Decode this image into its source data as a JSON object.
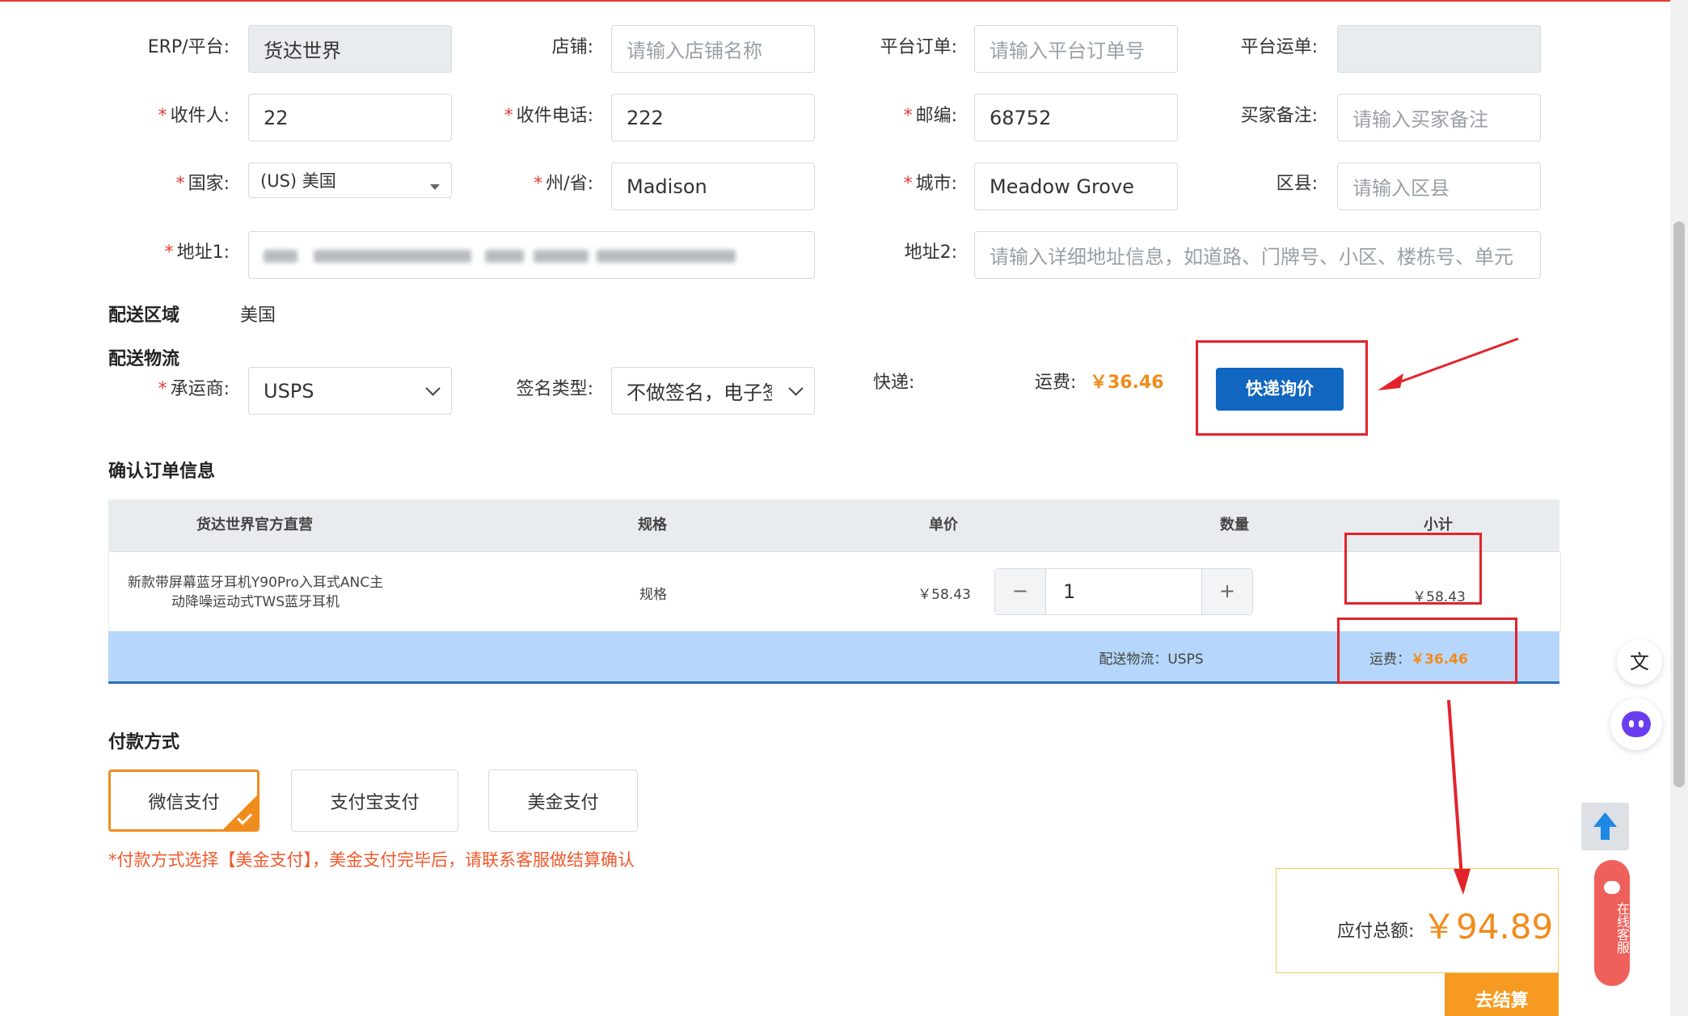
{
  "form": {
    "erp_label": "ERP/平台:",
    "erp_value": "货达世界",
    "store_label": "店铺:",
    "store_placeholder": "请输入店铺名称",
    "platform_order_label": "平台订单:",
    "platform_order_placeholder": "请输入平台订单号",
    "platform_waybill_label": "平台运单:",
    "platform_waybill_value": "",
    "recipient_label": "收件人:",
    "recipient_value": "22",
    "phone_label": "收件电话:",
    "phone_value": "222",
    "zip_label": "邮编:",
    "zip_value": "68752",
    "buyer_note_label": "买家备注:",
    "buyer_note_placeholder": "请输入买家备注",
    "country_label": "国家:",
    "country_value": "(US) 美国",
    "state_label": "州/省:",
    "state_value": "Madison",
    "city_label": "城市:",
    "city_value": "Meadow Grove",
    "district_label": "区县:",
    "district_placeholder": "请输入区县",
    "address1_label": "地址1:",
    "address2_label": "地址2:",
    "address2_placeholder": "请输入详细地址信息，如道路、门牌号、小区、楼栋号、单元"
  },
  "delivery": {
    "area_title": "配送区域",
    "area_value": "美国",
    "logistics_title": "配送物流",
    "carrier_label": "承运商:",
    "carrier_value": "USPS",
    "signature_label": "签名类型:",
    "signature_value": "不做签名，电子签名",
    "express_label": "快递:",
    "fee_label": "运费:",
    "fee_value": "￥36.46",
    "inquiry_button": "快递询价"
  },
  "order": {
    "title": "确认订单信息",
    "headers": [
      "货达世界官方直营",
      "规格",
      "单价",
      "数量",
      "小计"
    ],
    "row": {
      "product_line1": "新款带屏幕蓝牙耳机Y90Pro入耳式ANC主",
      "product_line2": "动降噪运动式TWS蓝牙耳机",
      "spec": "规格",
      "price": "￥58.43",
      "qty": "1",
      "minus": "−",
      "plus": "+",
      "subtotal": "￥58.43"
    },
    "shipping_row": {
      "logistics_text": "配送物流：USPS",
      "fee_label": "运费：",
      "fee_value": "￥36.46"
    }
  },
  "payment": {
    "title": "付款方式",
    "options": [
      "微信支付",
      "支付宝支付",
      "美金支付"
    ],
    "selected": "微信支付",
    "note": "*付款方式选择【美金支付】，美金支付完毕后，请联系客服做结算确认"
  },
  "total": {
    "label": "应付总额:",
    "value": "￥94.89",
    "checkout_button": "去结算"
  },
  "side": {
    "chat_label": "在线客服"
  },
  "colors": {
    "primary_blue": "#1166c0",
    "accent_orange": "#f08c1c",
    "annotation_red": "#e3232a",
    "required_red": "#e53935"
  }
}
